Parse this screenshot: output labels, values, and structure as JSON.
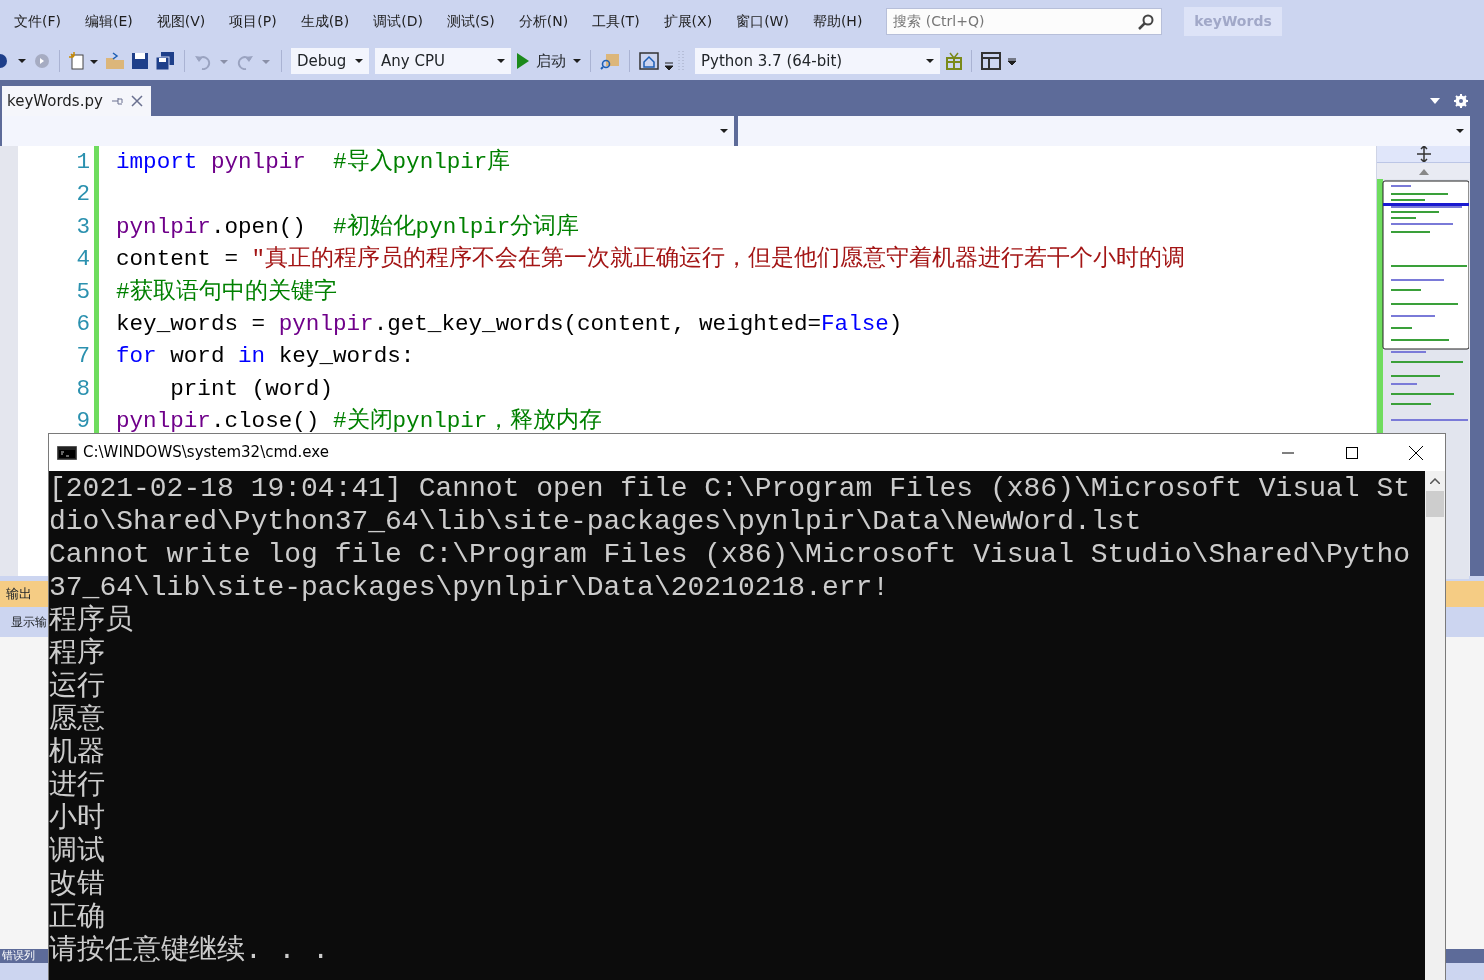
{
  "menu": [
    "文件(F)",
    "编辑(E)",
    "视图(V)",
    "项目(P)",
    "生成(B)",
    "调试(D)",
    "测试(S)",
    "分析(N)",
    "工具(T)",
    "扩展(X)",
    "窗口(W)",
    "帮助(H)"
  ],
  "search": {
    "placeholder": "搜索 (Ctrl+Q)"
  },
  "solution_name": "keyWords",
  "toolbar": {
    "configuration": "Debug",
    "platform": "Any CPU",
    "start": "启动",
    "environment": "Python 3.7 (64-bit)"
  },
  "tabs": [
    {
      "label": "keyWords.py",
      "selected": true
    }
  ],
  "editor": {
    "lines": [
      {
        "number": "1",
        "tokens": [
          {
            "text": "import",
            "kind": "keyword"
          },
          {
            "text": " pynlpir  ",
            "kind": "module"
          },
          {
            "text": "#导入pynlpir库",
            "kind": "comment"
          }
        ]
      },
      {
        "number": "2"
      },
      {
        "number": "3",
        "tokens": [
          {
            "text": "pynlpir",
            "kind": "module"
          },
          {
            "text": ".open()  ",
            "kind": "plain"
          },
          {
            "text": "#初始化pynlpir分词库",
            "kind": "comment"
          }
        ]
      },
      {
        "number": "4",
        "tokens": [
          {
            "text": "content = ",
            "kind": "plain"
          },
          {
            "text": "\"真正的程序员的程序不会在第一次就正确运行，但是他们愿意守着机器进行若干个小时的调",
            "kind": "string"
          }
        ]
      },
      {
        "number": "5",
        "tokens": [
          {
            "text": "#获取语句中的关键字",
            "kind": "comment"
          }
        ]
      },
      {
        "number": "6",
        "tokens": [
          {
            "text": "key_words = ",
            "kind": "plain"
          },
          {
            "text": "pynlpir",
            "kind": "module"
          },
          {
            "text": ".get_key_words(content, weighted=",
            "kind": "plain"
          },
          {
            "text": "False",
            "kind": "keyword"
          },
          {
            "text": ")",
            "kind": "plain"
          }
        ]
      },
      {
        "number": "7",
        "tokens": [
          {
            "text": "for",
            "kind": "keyword"
          },
          {
            "text": " word ",
            "kind": "plain"
          },
          {
            "text": "in",
            "kind": "keyword"
          },
          {
            "text": " key_words:",
            "kind": "plain"
          }
        ]
      },
      {
        "number": "8",
        "tokens": [
          {
            "text": "    print (word)",
            "kind": "plain"
          }
        ]
      },
      {
        "number": "9",
        "tokens": [
          {
            "text": "pynlpir",
            "kind": "module"
          },
          {
            "text": ".close() ",
            "kind": "plain"
          },
          {
            "text": "#关闭pynlpir，释放内存",
            "kind": "comment"
          }
        ]
      }
    ]
  },
  "output_panel": {
    "title": "输出",
    "toolbar_label": "显示输",
    "bottom_tab": "错误列"
  },
  "console": {
    "title": "C:\\WINDOWS\\system32\\cmd.exe",
    "lines": [
      "[2021-02-18 19:04:41] Cannot open file C:\\Program Files (x86)\\Microsoft Visual St",
      "dio\\Shared\\Python37_64\\lib\\site-packages\\pynlpir\\Data\\NewWord.lst",
      "Cannot write log file C:\\Program Files (x86)\\Microsoft Visual Studio\\Shared\\Pytho",
      "37_64\\lib\\site-packages\\pynlpir\\Data\\20210218.err!",
      "程序员",
      "程序",
      "运行",
      "愿意",
      "机器",
      "进行",
      "小时",
      "调试",
      "改错",
      "正确",
      "请按任意键继续. . ."
    ]
  }
}
